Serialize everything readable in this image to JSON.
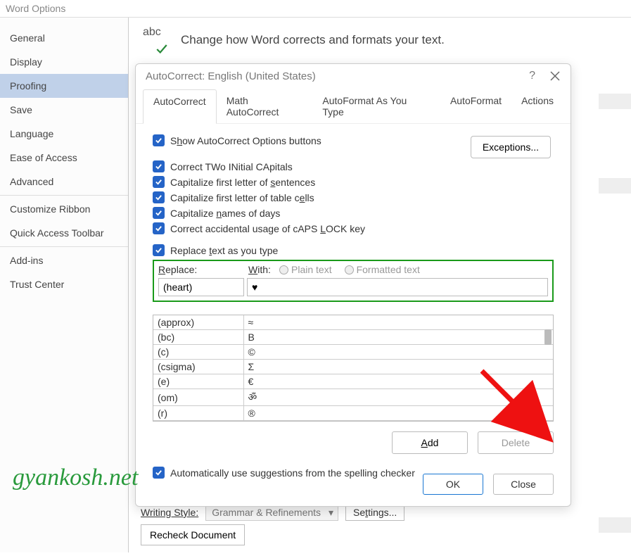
{
  "windowTitle": "Word Options",
  "sidebar": {
    "items": [
      "General",
      "Display",
      "Proofing",
      "Save",
      "Language",
      "Ease of Access",
      "Advanced",
      "Customize Ribbon",
      "Quick Access Toolbar",
      "Add-ins",
      "Trust Center"
    ],
    "activeIndex": 2,
    "separatorsAfter": [
      6,
      8
    ]
  },
  "heading": "Change how Word corrects and formats your text.",
  "bottom": {
    "writingStyleLabel": "Writing Style:",
    "writingStyleValue": "Grammar & Refinements",
    "settingsBtn": "Settings...",
    "recheckBtn": "Recheck Document"
  },
  "modal": {
    "title": "AutoCorrect: English (United States)",
    "tabs": [
      "AutoCorrect",
      "Math AutoCorrect",
      "AutoFormat As You Type",
      "AutoFormat",
      "Actions"
    ],
    "activeTab": 0,
    "checkboxes": {
      "showOptions": "Show AutoCorrect Options buttons",
      "twoCaps": "Correct TWo INitial CApitals",
      "firstSent": "Capitalize first letter of sentences",
      "tableCells": "Capitalize first letter of table cells",
      "daysNames": "Capitalize names of days",
      "capsLock": "Correct accidental usage of cAPS LOCK key",
      "replaceType": "Replace text as you type",
      "autoSugg": "Automatically use suggestions from the spelling checker"
    },
    "exceptionsBtn": "Exceptions...",
    "replaceLabel": "Replace:",
    "withLabel": "With:",
    "plainText": "Plain text",
    "formattedText": "Formatted text",
    "replaceValue": "(heart)",
    "withValue": "♥",
    "entries": [
      {
        "r": "(approx)",
        "w": "≈"
      },
      {
        "r": "(bc)",
        "w": "B"
      },
      {
        "r": "(c)",
        "w": "©"
      },
      {
        "r": "(csigma)",
        "w": "Σ"
      },
      {
        "r": "(e)",
        "w": "€"
      },
      {
        "r": "(om)",
        "w": "ॐ"
      },
      {
        "r": "(r)",
        "w": "®"
      }
    ],
    "addBtn": "Add",
    "deleteBtn": "Delete",
    "okBtn": "OK",
    "closeBtn": "Close"
  },
  "watermark": "gyankosh.net"
}
